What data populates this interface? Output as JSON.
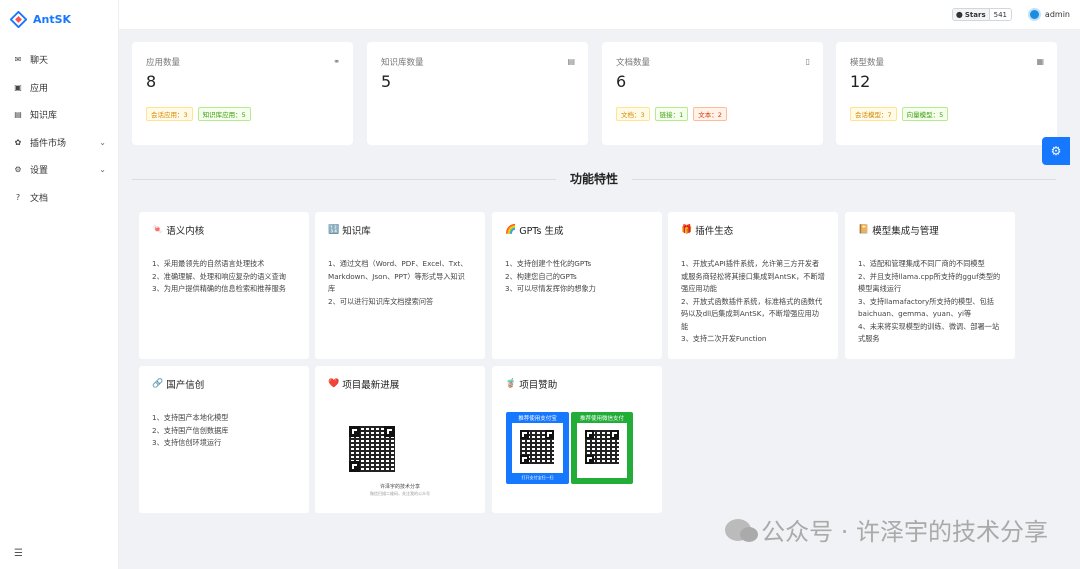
{
  "app": {
    "name": "AntSK"
  },
  "sidebar": {
    "items": [
      {
        "label": "聊天",
        "icon": "chat-icon"
      },
      {
        "label": "应用",
        "icon": "app-icon"
      },
      {
        "label": "知识库",
        "icon": "book-icon"
      },
      {
        "label": "插件市场",
        "icon": "plugin-icon",
        "expandable": true
      },
      {
        "label": "设置",
        "icon": "gear-icon",
        "expandable": true
      },
      {
        "label": "文档",
        "icon": "help-icon"
      }
    ]
  },
  "topbar": {
    "github": {
      "label": "Stars",
      "count": "541"
    },
    "user": "admin"
  },
  "stats": [
    {
      "title": "应用数量",
      "value": "8",
      "icon": "link-icon",
      "tags": [
        {
          "text": "会话应用：3",
          "color": "gold"
        },
        {
          "text": "知识库应用：5",
          "color": "green"
        }
      ]
    },
    {
      "title": "知识库数量",
      "value": "5",
      "icon": "book-icon",
      "tags": []
    },
    {
      "title": "文档数量",
      "value": "6",
      "icon": "file-icon",
      "tags": [
        {
          "text": "文档：3",
          "color": "gold"
        },
        {
          "text": "链接：1",
          "color": "green"
        },
        {
          "text": "文本：2",
          "color": "orange"
        }
      ]
    },
    {
      "title": "模型数量",
      "value": "12",
      "icon": "model-icon",
      "tags": [
        {
          "text": "会话模型：7",
          "color": "gold"
        },
        {
          "text": "向量模型：5",
          "color": "green"
        }
      ]
    }
  ],
  "section_title": "功能特性",
  "features": [
    {
      "icon": "🍬",
      "title": "语义内核",
      "desc": "1、采用最领先的自然语言处理技术\n2、准确理解、处理和响应复杂的语义查询\n3、为用户提供精确的信息检索和推荐服务"
    },
    {
      "icon": "🔢",
      "title": "知识库",
      "desc": "1、通过文档（Word、PDF、Excel、Txt、Markdown、Json、PPT）等形式导入知识库\n2、可以进行知识库文档搜索问答"
    },
    {
      "icon": "🌈",
      "title": "GPTs 生成",
      "desc": "1、支持创建个性化的GPTs\n2、构建您自己的GPTs\n3、可以尽情发挥你的想象力"
    },
    {
      "icon": "🎁",
      "title": "插件生态",
      "desc": "1、开放式API插件系统，允许第三方开发者或服务商轻松将其接口集成到AntSK，不断增强应用功能\n2、开放式函数插件系统，标准格式的函数代码以及dll后集成到AntSK，不断增强应用功能\n3、支持二次开发Function"
    },
    {
      "icon": "📔",
      "title": "模型集成与管理",
      "desc": "1、适配和管理集成不同厂商的不同模型\n2、并且支持llama.cpp所支持的gguf类型的模型离线运行\n3、支持llamafactory所支持的模型、包括baichuan、gemma、yuan、yi等\n4、未来将实现模型的训练、微调、部署一站式服务"
    },
    {
      "icon": "🔗",
      "title": "国产信创",
      "desc": "1、支持国产本地化模型\n2、支持国产信创数据库\n3、支持信创环境运行"
    },
    {
      "icon": "❤️",
      "title": "项目最新进展",
      "desc": ""
    },
    {
      "icon": "🧋",
      "title": "项目赞助",
      "desc": ""
    }
  ],
  "qr_card": {
    "caption": "许泽宇的技术分享",
    "subcaption": "微信扫描二维码，关注我的公众号"
  },
  "sponsor": {
    "alipay_title": "推荐使用支付宝",
    "wechat_title": "推荐使用微信支付",
    "alipay_bottom": "打开支付宝扫一扫"
  },
  "watermark": "公众号 · 许泽宇的技术分享",
  "colors": {
    "primary": "#1677ff",
    "alipay": "#1677ff",
    "wechat": "#22ac38"
  }
}
